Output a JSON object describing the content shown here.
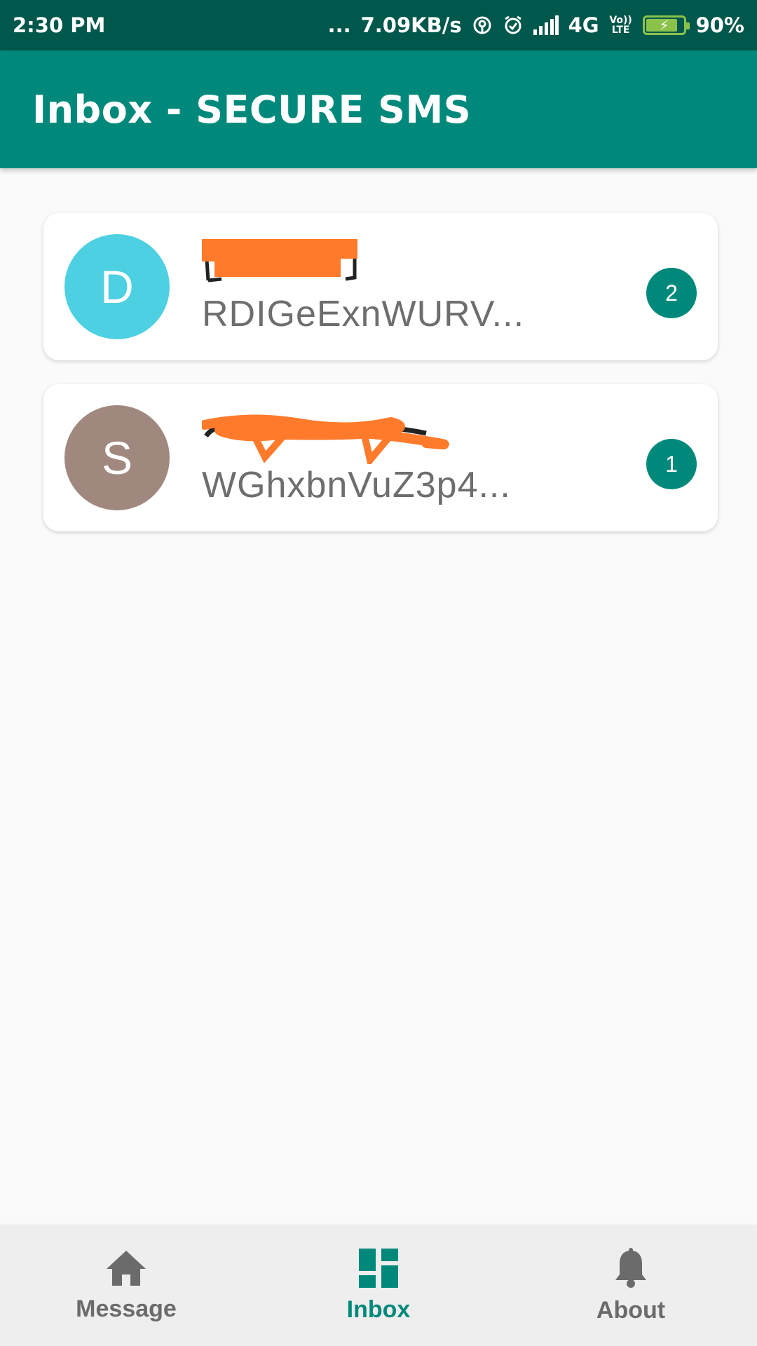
{
  "status_bar": {
    "time": "2:30 PM",
    "dots": "...",
    "net_speed": "7.09KB/s",
    "network": "4G",
    "volte": "Vo)) LTE",
    "battery": "90%"
  },
  "app_bar": {
    "title": "Inbox - SECURE SMS"
  },
  "conversations": [
    {
      "initial": "D",
      "avatar_color": "#4dd0e1",
      "sender": "",
      "preview": "RDIGeExnWURV...",
      "unread": "2"
    },
    {
      "initial": "S",
      "avatar_color": "#a1887f",
      "sender": "",
      "preview": "WGhxbnVuZ3p4...",
      "unread": "1"
    }
  ],
  "bottom_nav": [
    {
      "label": "Message",
      "icon": "home-icon",
      "active": false
    },
    {
      "label": "Inbox",
      "icon": "dashboard-icon",
      "active": true
    },
    {
      "label": "About",
      "icon": "bell-icon",
      "active": false
    }
  ],
  "colors": {
    "primary": "#00897b",
    "primary_dark": "#00574b",
    "redaction": "#ff7a2a"
  }
}
